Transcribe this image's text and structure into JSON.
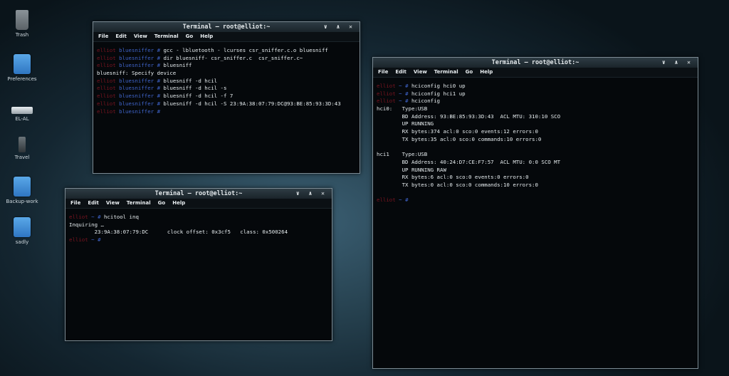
{
  "desktop": {
    "icons": [
      {
        "label": "Trash",
        "icon": "trash-icon"
      },
      {
        "label": "Preferences",
        "icon": "folder-icon"
      },
      {
        "label": "EL-AL",
        "icon": "drive-icon"
      },
      {
        "label": "Travel",
        "icon": "usb-drive-icon"
      },
      {
        "label": "Backup-work",
        "icon": "folder-icon"
      },
      {
        "label": "sadly",
        "icon": "folder-icon"
      }
    ]
  },
  "colors": {
    "prompt_user": "#7a1420",
    "prompt_path": "#3f63c8",
    "text": "#e6ecef"
  },
  "menu": [
    "File",
    "Edit",
    "View",
    "Terminal",
    "Go",
    "Help"
  ],
  "window_controls": "∨ ∧ ✕",
  "windows": [
    {
      "title": "Terminal – root@elliot:~",
      "lines": [
        {
          "user": "elliot",
          "path": "bluesniffer",
          "hash": "#",
          "cmd": " gcc - lbluetooth - lcurses csr_sniffer.c.o bluesniff"
        },
        {
          "user": "elliot",
          "path": "bluesniffer",
          "hash": "#",
          "cmd": " dir bluesniff- csr_sniffer.c  csr_sniffer.c~"
        },
        {
          "user": "elliot",
          "path": "bluesniffer",
          "hash": "#",
          "cmd": " bluesniff"
        },
        {
          "text": "bluesniff: Specify device"
        },
        {
          "user": "elliot",
          "path": "bluesniffer",
          "hash": "#",
          "cmd": " bluesniff -d hcil"
        },
        {
          "user": "elliot",
          "path": "bluesniffer",
          "hash": "#",
          "cmd": " bluesniff -d hcil -s"
        },
        {
          "user": "elliot",
          "path": "bluesniffer",
          "hash": "#",
          "cmd": " bluesniff -d hcil -f 7"
        },
        {
          "user": "elliot",
          "path": "bluesniffer",
          "hash": "#",
          "cmd": " bluesniff -d hcil -S 23:9A:38:07:79:DC@93:BE:85:93:3D:43"
        },
        {
          "user": "elliot",
          "path": "bluesniffer",
          "hash": "#",
          "cmd": ""
        }
      ]
    },
    {
      "title": "Terminal – root@elliot:~",
      "lines": [
        {
          "user": "elliot",
          "path": "~",
          "hash": "#",
          "cmd": " hcitool inq"
        },
        {
          "text": "Inquiring …"
        },
        {
          "text": "        23:9A:38:07:79:DC      clock offset: 0x3cf5   class: 0x500264"
        },
        {
          "user": "elliot",
          "path": "~",
          "hash": "#",
          "cmd": ""
        }
      ]
    },
    {
      "title": "Terminal – root@elliot:~",
      "lines": [
        {
          "user": "elliot",
          "path": "~",
          "hash": "#",
          "cmd": " hciconfig hci0 up"
        },
        {
          "user": "elliot",
          "path": "~",
          "hash": "#",
          "cmd": " hciconfig hci1 up"
        },
        {
          "user": "elliot",
          "path": "~",
          "hash": "#",
          "cmd": " hciconfig"
        },
        {
          "text": "hci0:   Type:USB"
        },
        {
          "text": "        BD Address: 93:BE:85:93:3D:43  ACL MTU: 310:10 SCO"
        },
        {
          "text": "        UP RUNNING"
        },
        {
          "text": "        RX bytes:374 acl:0 sco:0 events:12 errors:0"
        },
        {
          "text": "        TX bytes:35 acl:0 sco:0 commands:10 errors:0"
        },
        {
          "text": ""
        },
        {
          "text": "hci1    Type:USB"
        },
        {
          "text": "        BD Address: 40:24:D7:CE:F7:57  ACL MTU: 0:0 SCO MT"
        },
        {
          "text": "        UP RUNNING RAW"
        },
        {
          "text": "        RX bytes:6 acl:0 sco:0 events:0 errors:0"
        },
        {
          "text": "        TX bytes:0 acl:0 sco:0 commands:10 errors:0"
        },
        {
          "text": ""
        },
        {
          "user": "elliot",
          "path": "~",
          "hash": "#",
          "cmd": ""
        }
      ]
    }
  ]
}
